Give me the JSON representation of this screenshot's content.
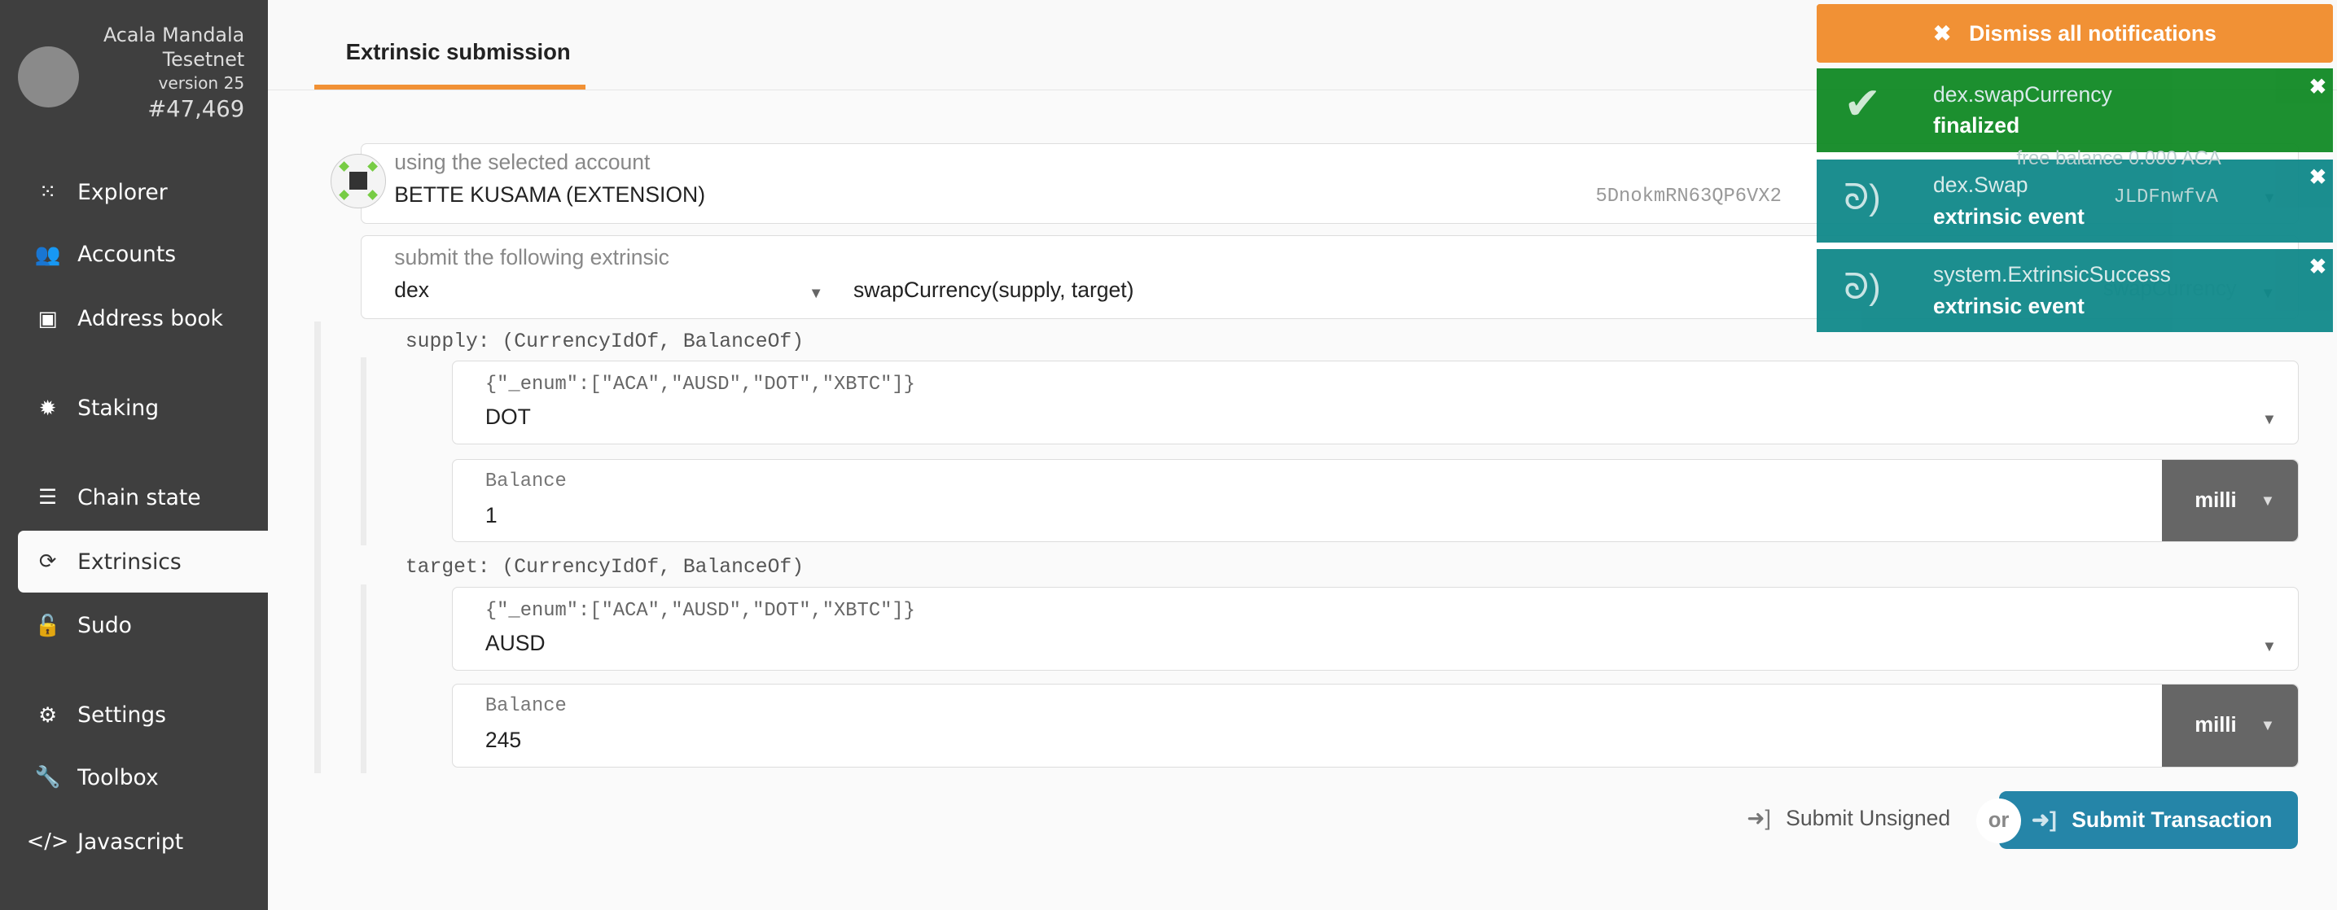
{
  "chain": {
    "name": "Acala Mandala Tesetnet",
    "name_line1": "Acala Mandala",
    "name_line2": "Tesetnet",
    "version": "version 25",
    "block": "#47,469"
  },
  "sidebar": {
    "items": [
      {
        "label": "Explorer",
        "icon": "explorer-icon"
      },
      {
        "label": "Accounts",
        "icon": "users-icon"
      },
      {
        "label": "Address book",
        "icon": "address-book-icon"
      },
      {
        "label": "Staking",
        "icon": "certificate-icon"
      },
      {
        "label": "Chain state",
        "icon": "database-icon"
      },
      {
        "label": "Extrinsics",
        "icon": "sync-icon",
        "active": true
      },
      {
        "label": "Sudo",
        "icon": "unlock-icon"
      },
      {
        "label": "Settings",
        "icon": "cogs-icon"
      },
      {
        "label": "Toolbox",
        "icon": "wrench-icon"
      },
      {
        "label": "Javascript",
        "icon": "code-icon"
      }
    ]
  },
  "header": {
    "tab": "Extrinsic submission"
  },
  "account": {
    "label": "using the selected account",
    "name": "BETTE KUSAMA (EXTENSION)",
    "address": "5DnokmRN63QP6VX2",
    "address_tail": "JLDFnwfvA",
    "balance": "free balance 0.000 ACA"
  },
  "extrinsic": {
    "label": "submit the following extrinsic",
    "section": "dex",
    "method": "swapCurrency(supply, target)",
    "method_ghost": "swapCurrency"
  },
  "params": [
    {
      "label": "supply: (CurrencyIdOf, BalanceOf)",
      "enum_label": "{\"_enum\":[\"ACA\",\"AUSD\",\"DOT\",\"XBTC\"]}",
      "enum_value": "DOT",
      "balance_label": "Balance",
      "balance_value": "1",
      "unit": "milli"
    },
    {
      "label": "target: (CurrencyIdOf, BalanceOf)",
      "enum_label": "{\"_enum\":[\"ACA\",\"AUSD\",\"DOT\",\"XBTC\"]}",
      "enum_value": "AUSD",
      "balance_label": "Balance",
      "balance_value": "245",
      "unit": "milli"
    }
  ],
  "actions": {
    "unsigned": "Submit Unsigned",
    "or": "or",
    "submit": "Submit Transaction"
  },
  "notifications": {
    "dismiss": "Dismiss all notifications",
    "items": [
      {
        "title": "dex.swapCurrency",
        "status": "finalized",
        "color": "#118a25"
      },
      {
        "title": "dex.Swap",
        "status": "extrinsic event",
        "color": "#10898a"
      },
      {
        "title": "system.ExtrinsicSuccess",
        "status": "extrinsic event",
        "color": "#10898a"
      }
    ]
  },
  "colors": {
    "accent": "#f19135",
    "submit": "#2585a8",
    "sidebar": "#3f3f3f"
  }
}
